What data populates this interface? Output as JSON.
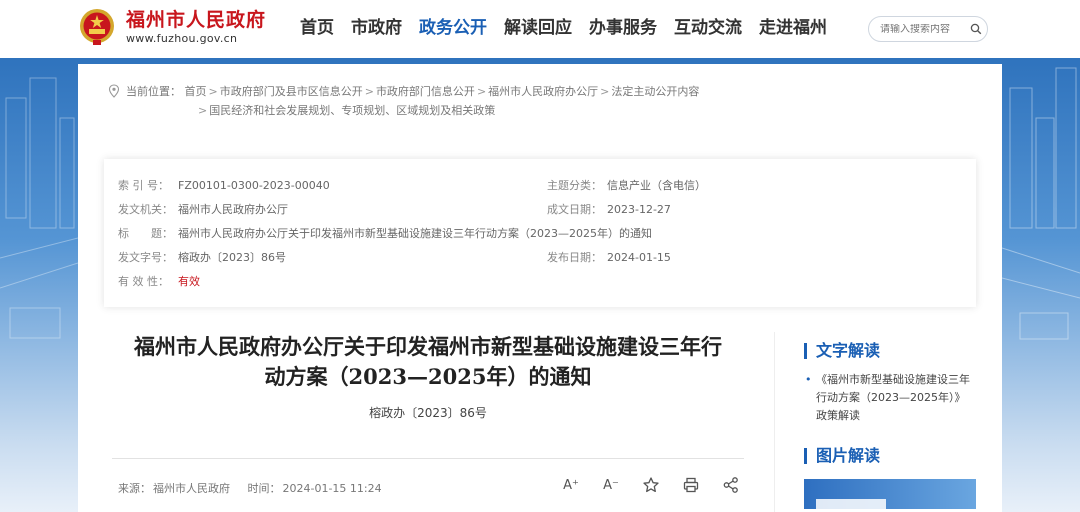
{
  "header": {
    "site_name": "福州市人民政府",
    "site_domain": "www.fuzhou.gov.cn",
    "nav": [
      {
        "label": "首页",
        "active": false
      },
      {
        "label": "市政府",
        "active": false
      },
      {
        "label": "政务公开",
        "active": true
      },
      {
        "label": "解读回应",
        "active": false
      },
      {
        "label": "办事服务",
        "active": false
      },
      {
        "label": "互动交流",
        "active": false
      },
      {
        "label": "走进福州",
        "active": false
      }
    ],
    "search_placeholder": "请输入搜索内容"
  },
  "breadcrumb": {
    "prefix": "当前位置：",
    "items": [
      "首页",
      "市政府部门及县市区信息公开",
      "市政府部门信息公开",
      "福州市人民政府办公厅",
      "法定主动公开内容"
    ],
    "last": "国民经济和社会发展规划、专项规划、区域规划及相关政策"
  },
  "meta": {
    "index_label": "索 引 号：",
    "index_value": "FZ00101-0300-2023-00040",
    "topic_label": "主题分类：",
    "topic_value": "信息产业（含电信）",
    "issuer_label": "发文机关：",
    "issuer_value": "福州市人民政府办公厅",
    "date_label": "成文日期：",
    "date_value": "2023-12-27",
    "title_label": "标　　题：",
    "title_value": "福州市人民政府办公厅关于印发福州市新型基础设施建设三年行动方案（2023—2025年）的通知",
    "docno_label": "发文字号：",
    "docno_value": "榕政办〔2023〕86号",
    "pubdate_label": "发布日期：",
    "pubdate_value": "2024-01-15",
    "valid_label": "有 效 性：",
    "valid_value": "有效"
  },
  "article": {
    "title_line1": "福州市人民政府办公厅关于印发福州市新型基础设施建设三年行",
    "title_line2": "动方案（2023—2025年）的通知",
    "doc_number": "榕政办〔2023〕86号",
    "source_label": "来源：",
    "source_value": "福州市人民政府",
    "time_label": "时间：",
    "time_value": "2024-01-15 11:24",
    "tools": {
      "font_larger": "A⁺",
      "font_smaller": "A⁻"
    }
  },
  "sidebar": {
    "text_heading": "文字解读",
    "text_link_line1": "《福州市新型基础设施建设三年",
    "text_link_line2": "行动方案（2023—2025年）》",
    "text_link_line3": "政策解读",
    "image_heading": "图片解读"
  },
  "colors": {
    "brand_red": "#c8161d",
    "accent_blue": "#1a5fb4",
    "band_blue": "#2f73bd"
  }
}
